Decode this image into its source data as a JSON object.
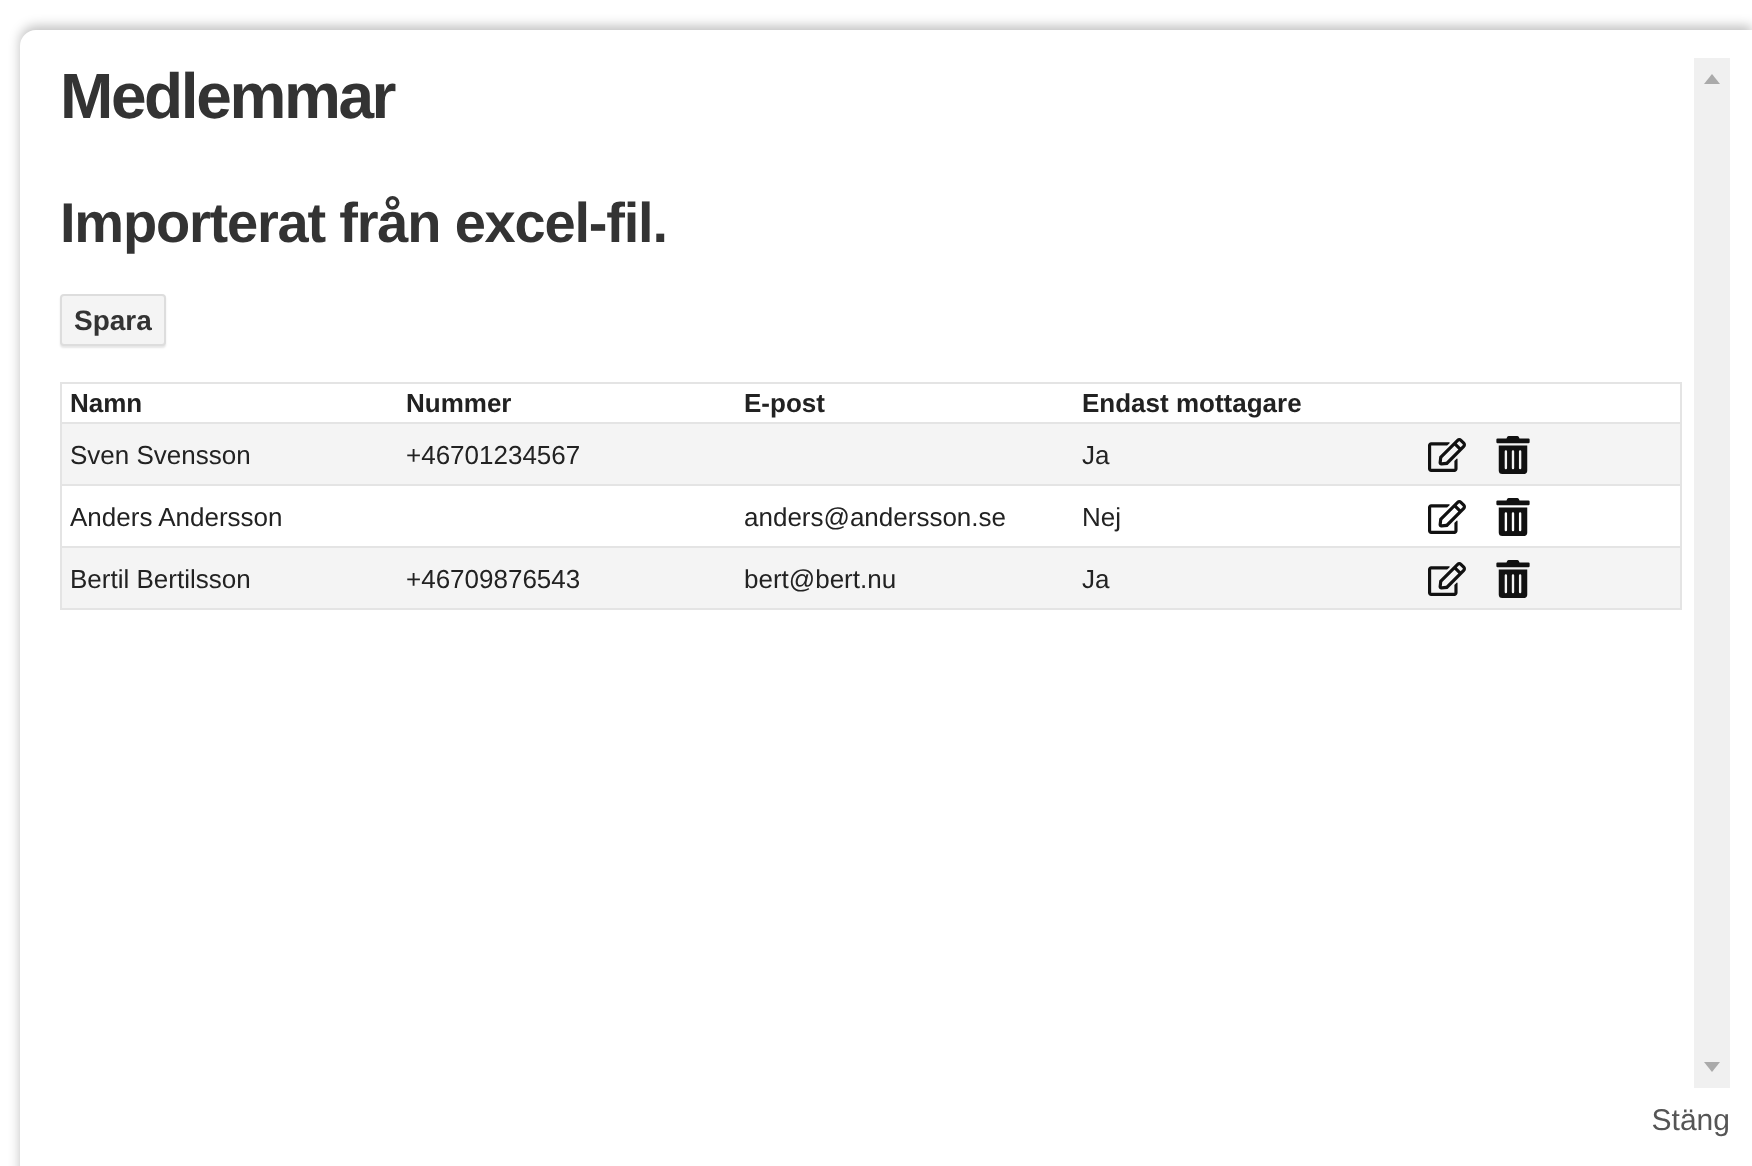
{
  "title": "Medlemmar",
  "subtitle": "Importerat från excel-fil.",
  "save_button": "Spara",
  "table": {
    "columns": [
      "Namn",
      "Nummer",
      "E-post",
      "Endast mottagare"
    ],
    "rows": [
      {
        "cells": [
          "Sven Svensson",
          "+46701234567",
          "",
          "Ja"
        ]
      },
      {
        "cells": [
          "Anders Andersson",
          "",
          "anders@andersson.se",
          "Nej"
        ]
      },
      {
        "cells": [
          "Bertil Bertilsson",
          "+46709876543",
          "bert@bert.nu",
          "Ja"
        ]
      }
    ]
  },
  "close_link": "Stäng"
}
